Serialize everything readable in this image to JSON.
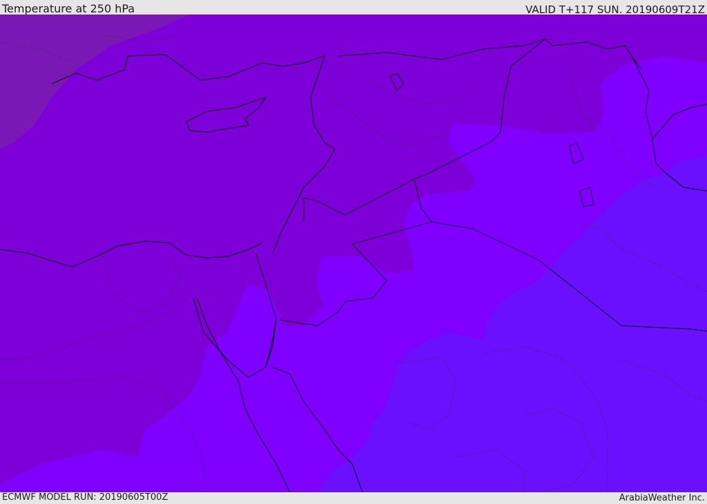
{
  "header": {
    "title": "Temperature at 250 hPa",
    "valid_time": "VALID T+117 SUN. 20190609T21Z"
  },
  "footer": {
    "model_run": "ECMWF MODEL RUN: 20190605T00Z",
    "credit": "ArabiaWeather Inc."
  },
  "map": {
    "field": "temperature",
    "level": "250 hPa",
    "palette": {
      "coldest_band": "#7a18b6",
      "cold_band": "#7d00d8",
      "mid_band": "#7f00fe",
      "warm_band": "#6a10ff",
      "coastline_color": "#000000",
      "border_color": "#222222"
    }
  }
}
